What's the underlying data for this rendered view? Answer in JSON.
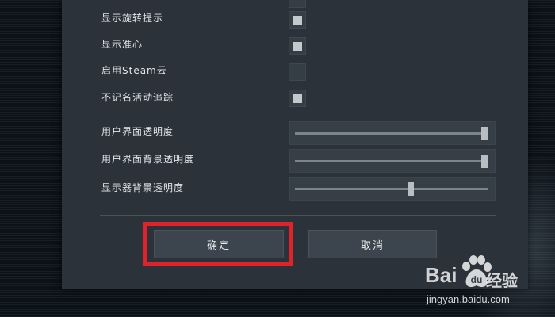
{
  "settings": {
    "checkboxes": [
      {
        "label": "显示旋转提示",
        "checked": true
      },
      {
        "label": "显示准心",
        "checked": true
      },
      {
        "label": "启用Steam云",
        "checked": false
      },
      {
        "label": "不记名活动追踪",
        "checked": true
      }
    ],
    "sliders": [
      {
        "label": "用户界面透明度",
        "value": 0.98
      },
      {
        "label": "用户界面背景透明度",
        "value": 0.98
      },
      {
        "label": "显示器背景透明度",
        "value": 0.6
      }
    ]
  },
  "buttons": {
    "confirm_label": "确定",
    "cancel_label": "取消"
  },
  "highlight": {
    "color": "#e0232b",
    "target": "confirm-button"
  },
  "watermark": {
    "brand_left": "Bai",
    "brand_right": "经验",
    "url": "jingyan.baidu.com"
  }
}
